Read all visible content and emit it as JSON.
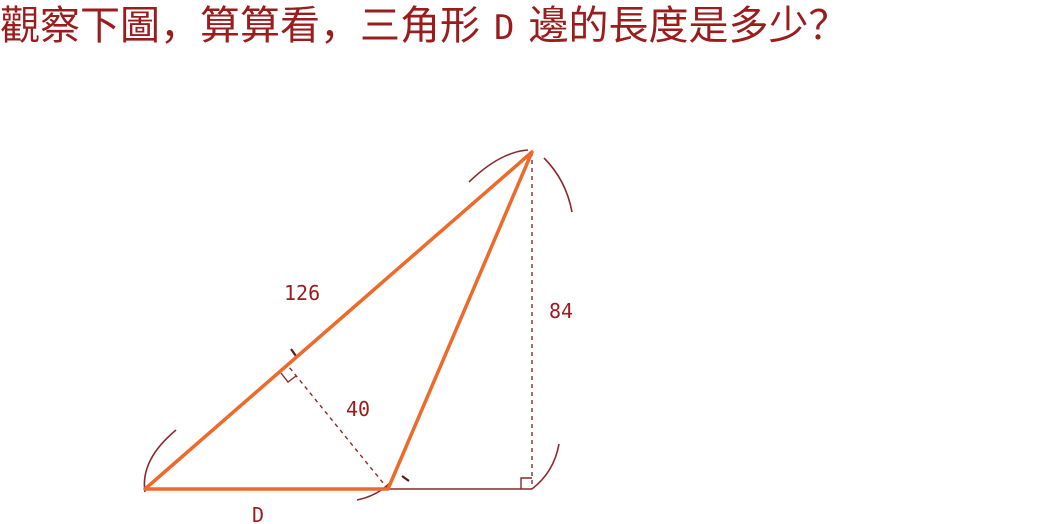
{
  "question": {
    "part1": "觀察下圖，算算看，三角形",
    "variable": "D",
    "part2": "邊的長度是多少？"
  },
  "diagram": {
    "labels": {
      "slant_side": "126",
      "height": "84",
      "perpendicular": "40",
      "base": "D"
    },
    "colors": {
      "triangle": "#ee6a2a",
      "construction": "#8b2a2a",
      "text": "#9b1c1c"
    }
  }
}
